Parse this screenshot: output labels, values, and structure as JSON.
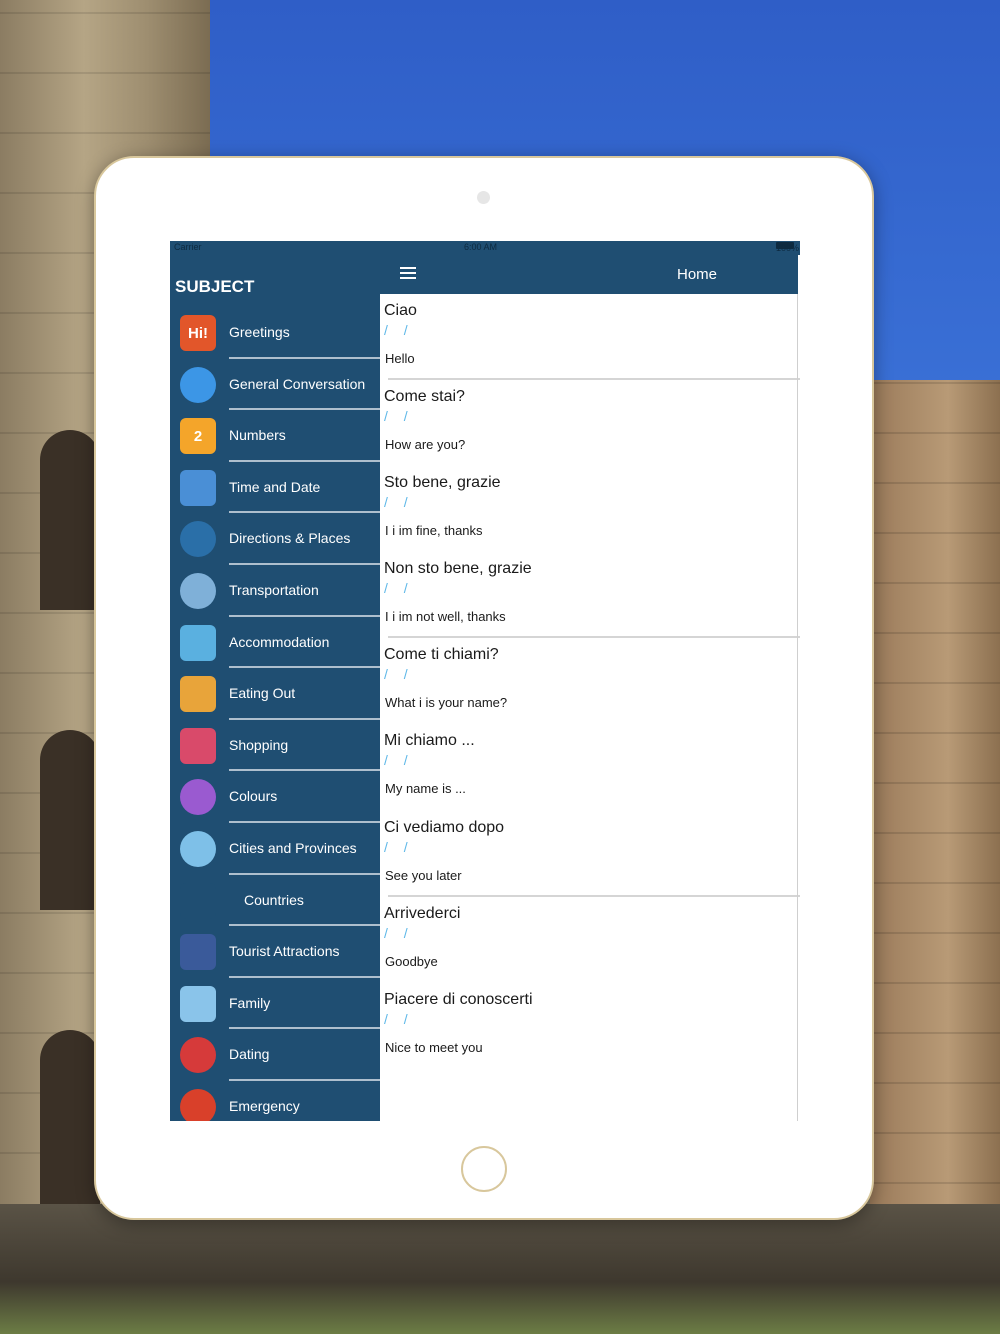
{
  "status_bar": {
    "carrier": "Carrier",
    "time": "6:00 AM",
    "battery": "100%"
  },
  "sidebar": {
    "title": "SUBJECT",
    "items": [
      {
        "label": "Greetings",
        "icon": "hi-greeting-icon",
        "icon_text": "Hi!",
        "color": "#e2562a"
      },
      {
        "label": "General Conversation",
        "icon": "speech-bubbles-icon",
        "icon_text": "",
        "color": "#3c96e6"
      },
      {
        "label": "Numbers",
        "icon": "number-two-icon",
        "icon_text": "2",
        "color": "#f4a52a"
      },
      {
        "label": "Time and Date",
        "icon": "calendar-clock-icon",
        "icon_text": "",
        "color": "#4a8fd6"
      },
      {
        "label": "Directions & Places",
        "icon": "compass-icon",
        "icon_text": "",
        "color": "#2a6fa8"
      },
      {
        "label": "Transportation",
        "icon": "bus-icon",
        "icon_text": "",
        "color": "#7fb0d8"
      },
      {
        "label": "Accommodation",
        "icon": "beach-icon",
        "icon_text": "",
        "color": "#5ab0e0"
      },
      {
        "label": "Eating Out",
        "icon": "food-icon",
        "icon_text": "",
        "color": "#e8a43a"
      },
      {
        "label": "Shopping",
        "icon": "shopping-bags-icon",
        "icon_text": "",
        "color": "#d94a6a"
      },
      {
        "label": "Colours",
        "icon": "color-wheel-icon",
        "icon_text": "",
        "color": "#9a5ad0"
      },
      {
        "label": "Cities and Provinces",
        "icon": "city-icon",
        "icon_text": "",
        "color": "#7ec0e8"
      },
      {
        "label": "Countries",
        "icon": "map-pins-icon",
        "icon_text": "",
        "color": "#1f4e72"
      },
      {
        "label": "Tourist Attractions",
        "icon": "landmark-photo-icon",
        "icon_text": "",
        "color": "#3a5a9a"
      },
      {
        "label": "Family",
        "icon": "family-icon",
        "icon_text": "",
        "color": "#8ac4ea"
      },
      {
        "label": "Dating",
        "icon": "heart-icon",
        "icon_text": "",
        "color": "#d63a3a"
      },
      {
        "label": "Emergency",
        "icon": "emergency-icon",
        "icon_text": "",
        "color": "#d9402a"
      }
    ]
  },
  "header": {
    "title": "Home",
    "menu_icon": "hamburger-menu-icon"
  },
  "phrases": [
    {
      "italian": "Ciao",
      "slashes": "/ /",
      "english": "Hello"
    },
    {
      "italian": "Come stai?",
      "slashes": "/ /",
      "english": "How are you?"
    },
    {
      "italian": "Sto bene, grazie",
      "slashes": "/ /",
      "english": "I i im fine, thanks"
    },
    {
      "italian": "Non sto bene, grazie",
      "slashes": "/ /",
      "english": "I i im not well, thanks"
    },
    {
      "italian": "Come ti chiami?",
      "slashes": "/ /",
      "english": "What i is your name?"
    },
    {
      "italian": "Mi chiamo ...",
      "slashes": "/ /",
      "english": "My name is ..."
    },
    {
      "italian": "Ci vediamo dopo",
      "slashes": "/ /",
      "english": "See you later"
    },
    {
      "italian": "Arrivederci",
      "slashes": "/ /",
      "english": "Goodbye"
    },
    {
      "italian": "Piacere di conoscerti",
      "slashes": "/ /",
      "english": "Nice to meet you"
    }
  ]
}
